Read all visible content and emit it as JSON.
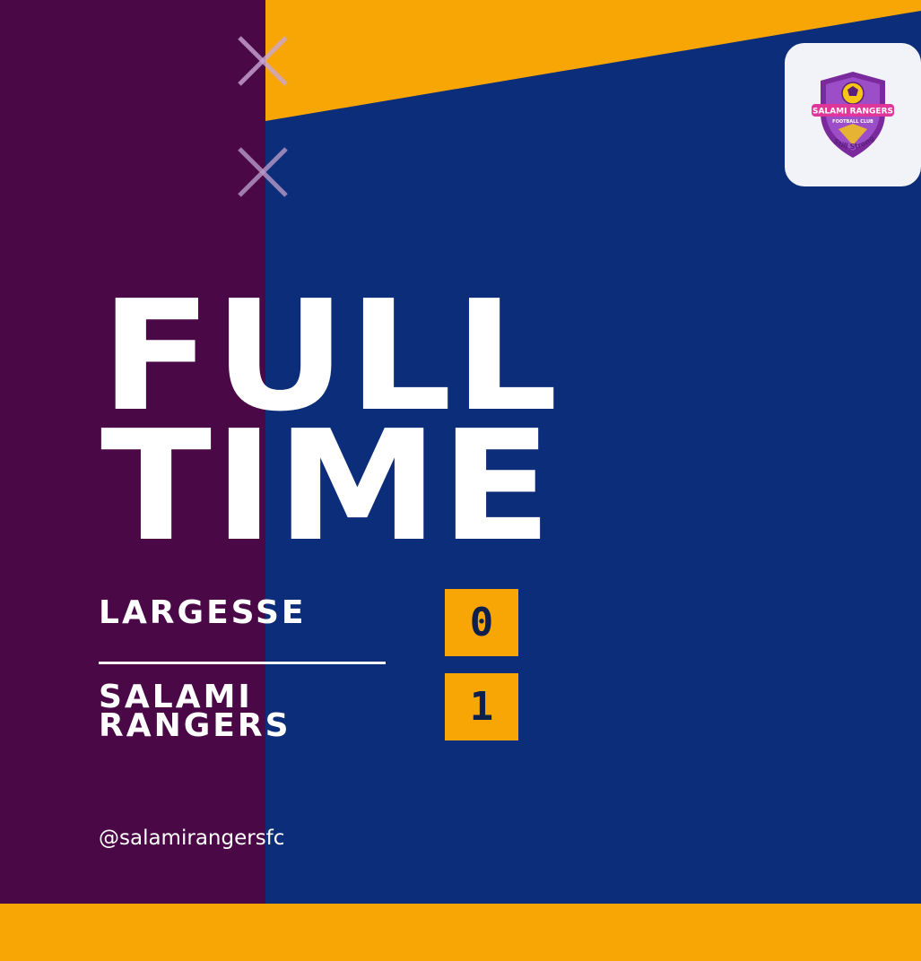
{
  "headline": {
    "line1": "FULL",
    "line2": "TIME"
  },
  "logo": {
    "name_text": "SALAMI RANGERS",
    "subtitle_text": "FOOTBALL CLUB",
    "motto_text": "Still Strong",
    "icon": "club-crest-icon"
  },
  "match": {
    "home": {
      "name": "LARGESSE",
      "score": "0"
    },
    "away": {
      "name_line1": "SALAMI",
      "name_line2": "RANGERS",
      "score": "1"
    }
  },
  "social_handle": "@salamirangersfc",
  "colors": {
    "purple": "#4a0847",
    "navy": "#0c2d7a",
    "gold": "#f8a605",
    "white": "#ffffff",
    "score_text": "#0c1f4d"
  },
  "decorations": {
    "icons": [
      "cross-icon",
      "cross-icon"
    ]
  }
}
